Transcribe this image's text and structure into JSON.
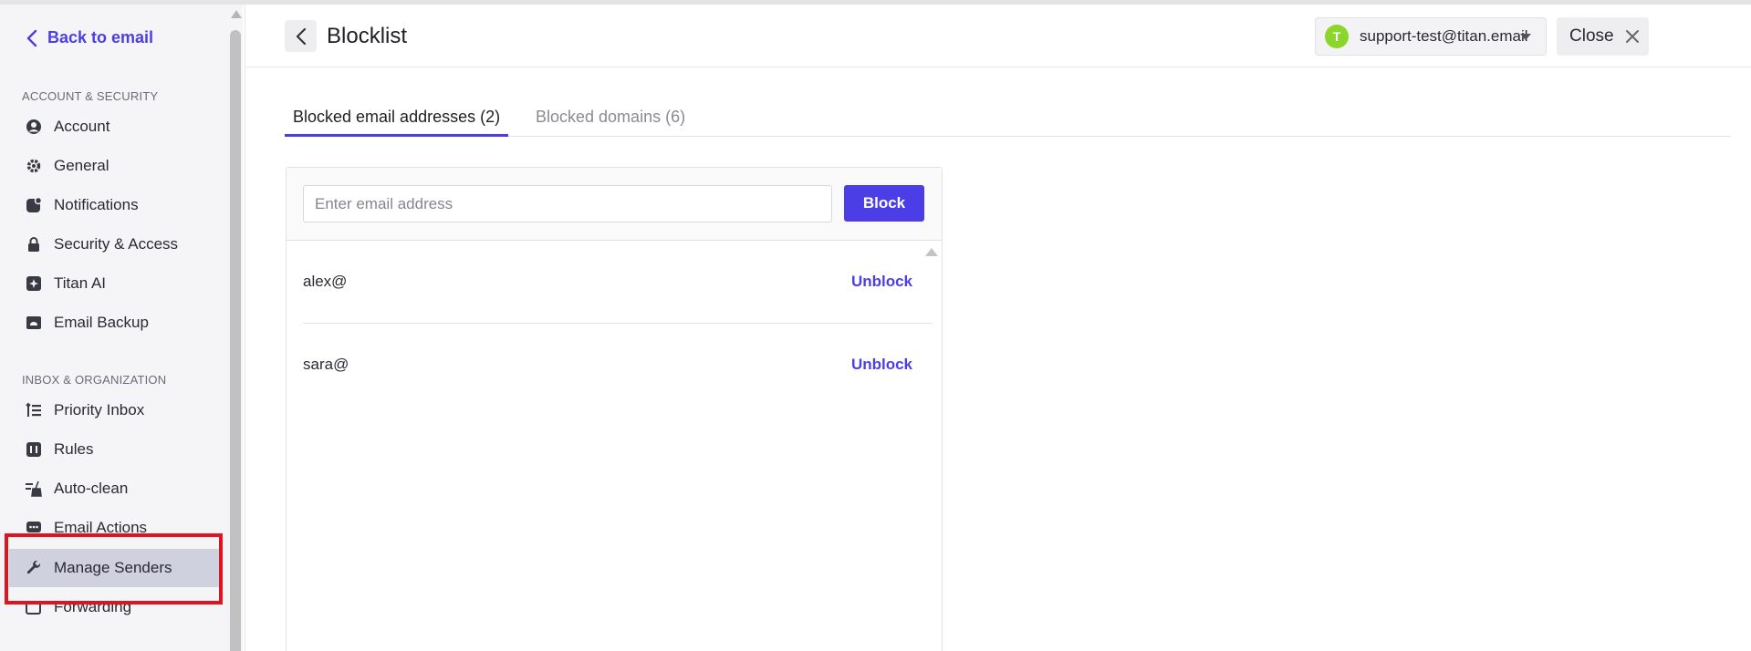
{
  "sidebar": {
    "back_label": "Back to email",
    "sections": [
      {
        "label": "ACCOUNT & SECURITY"
      },
      {
        "label": "INBOX & ORGANIZATION"
      }
    ],
    "items": [
      {
        "label": "Account",
        "icon": "user-circle-icon"
      },
      {
        "label": "General",
        "icon": "gear-icon"
      },
      {
        "label": "Notifications",
        "icon": "notification-icon"
      },
      {
        "label": "Security & Access",
        "icon": "lock-icon"
      },
      {
        "label": "Titan AI",
        "icon": "sparkle-icon"
      },
      {
        "label": "Email Backup",
        "icon": "backup-icon"
      },
      {
        "label": "Priority Inbox",
        "icon": "priority-icon"
      },
      {
        "label": "Rules",
        "icon": "rules-icon"
      },
      {
        "label": "Auto-clean",
        "icon": "broom-icon"
      },
      {
        "label": "Email Actions",
        "icon": "chat-icon"
      },
      {
        "label": "Manage Senders",
        "icon": "wrench-icon",
        "active": true
      },
      {
        "label": "Forwarding",
        "icon": "forward-icon"
      }
    ]
  },
  "header": {
    "title": "Blocklist",
    "account": {
      "initial": "T",
      "email": "support-test@titan.email",
      "avatar_color": "#8cd62c"
    },
    "close_label": "Close"
  },
  "tabs": [
    {
      "label": "Blocked email addresses (2)",
      "active": true
    },
    {
      "label": "Blocked domains (6)",
      "active": false
    }
  ],
  "block_form": {
    "placeholder": "Enter email address",
    "button_label": "Block"
  },
  "blocked_emails": [
    {
      "email": "alex@",
      "action": "Unblock"
    },
    {
      "email": "sara@",
      "action": "Unblock"
    }
  ],
  "colors": {
    "accent": "#4c3ee6",
    "highlight": "#e0141e",
    "active_nav_bg": "#d0d1de"
  }
}
